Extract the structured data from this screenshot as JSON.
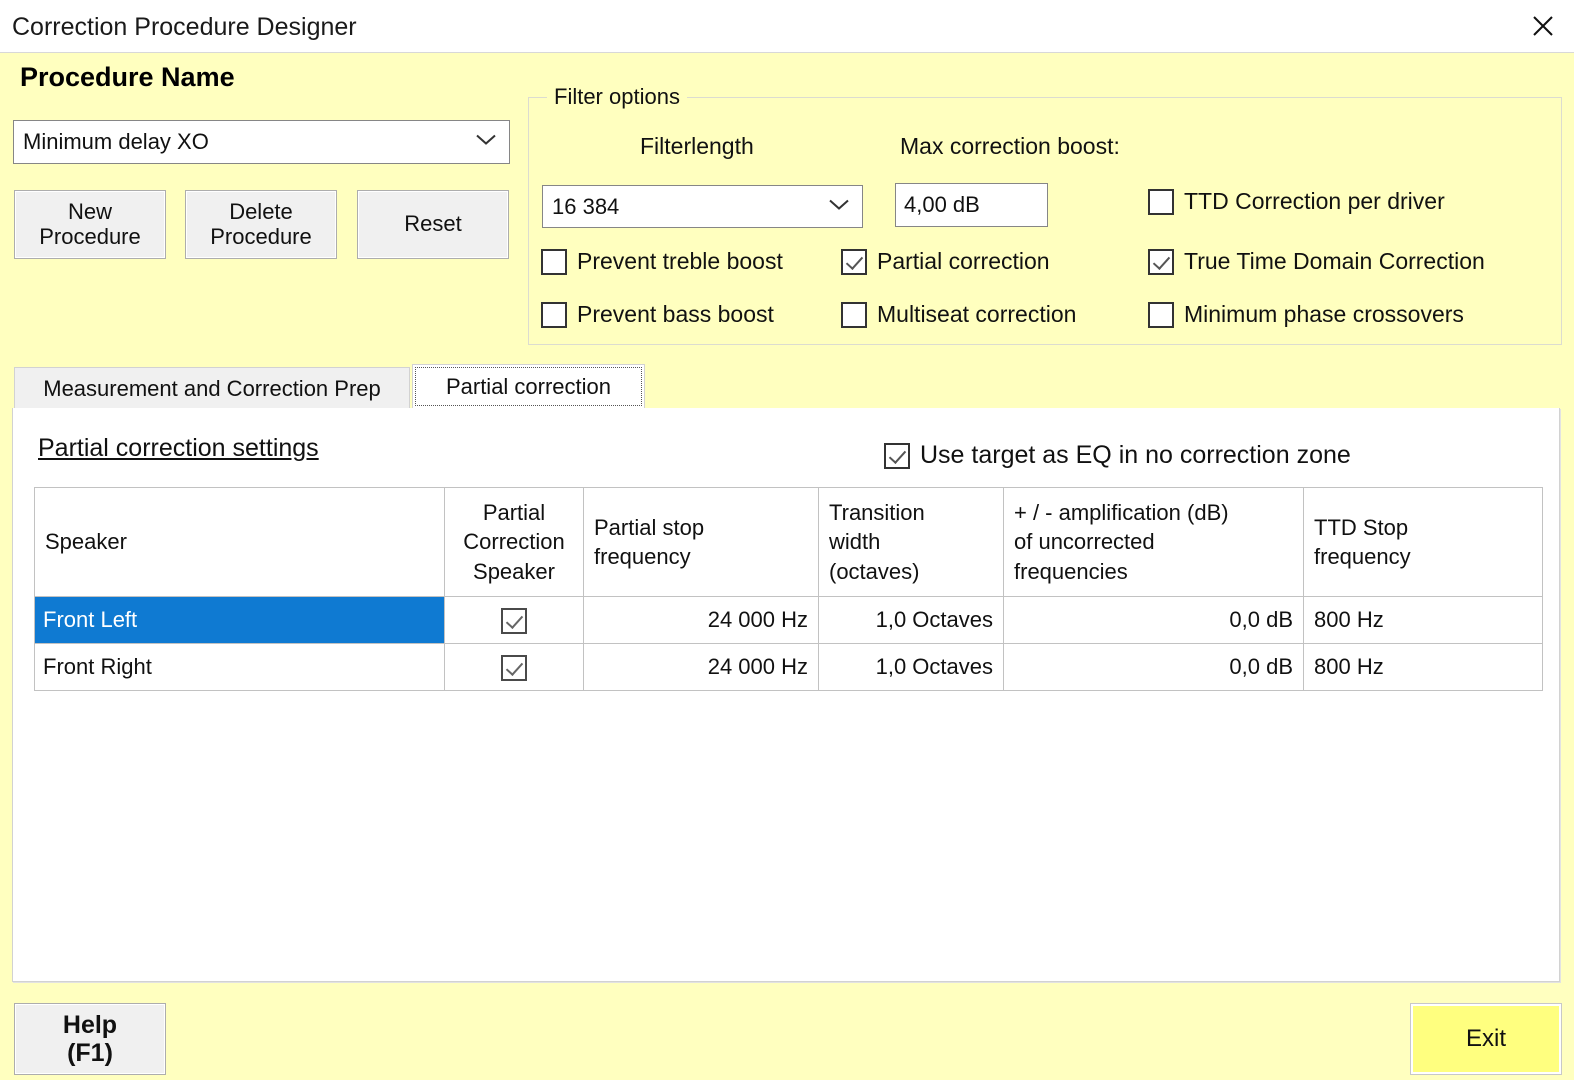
{
  "window": {
    "title": "Correction Procedure Designer",
    "close_icon": "close-icon"
  },
  "procedure": {
    "label": "Procedure Name",
    "selected": "Minimum delay XO",
    "dropdown_icon": "chevron-down-icon",
    "buttons": {
      "new": "New\nProcedure",
      "new_line1": "New",
      "new_line2": "Procedure",
      "delete_line1": "Delete",
      "delete_line2": "Procedure",
      "reset": "Reset"
    }
  },
  "filter_options": {
    "group_title": "Filter options",
    "filterlength_label": "Filterlength",
    "filterlength_value": "16 384",
    "max_boost_label": "Max correction boost:",
    "max_boost_value": "4,00 dB",
    "checkboxes": [
      {
        "label": "Prevent treble boost",
        "checked": false
      },
      {
        "label": "Prevent bass boost",
        "checked": false
      },
      {
        "label": "Partial correction",
        "checked": true
      },
      {
        "label": "Multiseat correction",
        "checked": false
      },
      {
        "label": "TTD Correction per driver",
        "checked": false
      },
      {
        "label": "True Time Domain Correction",
        "checked": true
      },
      {
        "label": "Minimum phase crossovers",
        "checked": false
      }
    ]
  },
  "tabs": [
    {
      "label": "Measurement and Correction Prep",
      "active": false
    },
    {
      "label": "Partial correction",
      "active": true
    }
  ],
  "partial_correction": {
    "section_title": "Partial correction settings",
    "use_target_label": "Use target as EQ in no correction zone",
    "use_target_checked": true,
    "table": {
      "headers": [
        "Speaker",
        "Partial\nCorrection\nSpeaker",
        "Partial stop\nfrequency",
        "Transition\nwidth\n(octaves)",
        "+ / - amplification (dB)\nof uncorrected\nfrequencies",
        "TTD Stop\nfrequency"
      ],
      "header_lines": {
        "speaker": [
          "Speaker"
        ],
        "partial_correction_speaker": [
          "Partial",
          "Correction",
          "Speaker"
        ],
        "partial_stop_frequency": [
          "Partial stop",
          "frequency"
        ],
        "transition_width": [
          "Transition",
          "width",
          "(octaves)"
        ],
        "amplification": [
          "+ / - amplification (dB)",
          "of uncorrected",
          "frequencies"
        ],
        "ttd_stop_frequency": [
          "TTD Stop",
          "frequency"
        ]
      },
      "rows": [
        {
          "speaker": "Front Left",
          "partial_correction_speaker": true,
          "partial_stop_frequency": "24 000 Hz",
          "transition_width": "1,0 Octaves",
          "amplification": "0,0 dB",
          "ttd_stop_frequency": "800 Hz",
          "selected": true
        },
        {
          "speaker": "Front Right",
          "partial_correction_speaker": true,
          "partial_stop_frequency": "24 000 Hz",
          "transition_width": "1,0 Octaves",
          "amplification": "0,0 dB",
          "ttd_stop_frequency": "800 Hz",
          "selected": false
        }
      ]
    }
  },
  "footer": {
    "help_line1": "Help",
    "help_line2": "(F1)",
    "exit": "Exit"
  },
  "colors": {
    "background": "#ffffbf",
    "selection": "#0f7ad2",
    "exit_button": "#ffff7f",
    "button_face": "#f0f0f0",
    "panel": "#ffffff"
  }
}
